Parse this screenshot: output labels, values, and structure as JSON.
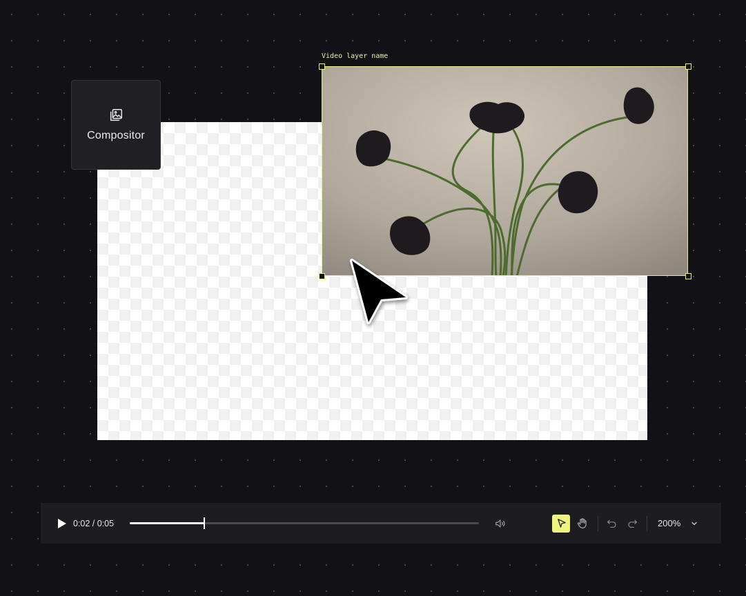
{
  "compositor": {
    "label": "Compositor",
    "icon": "image-stack-icon"
  },
  "video_layer": {
    "name": "Video layer name",
    "selection_color": "#e6f08a"
  },
  "player": {
    "time": "0:02 / 0:05",
    "progress_fraction": 0.214,
    "zoom": "200%"
  },
  "tools": {
    "select": {
      "icon": "cursor-arrow-icon",
      "active": true,
      "active_color": "#eef57d"
    },
    "pan": {
      "icon": "hand-icon",
      "active": false
    },
    "undo": {
      "icon": "undo-icon"
    },
    "redo": {
      "icon": "redo-icon"
    }
  },
  "colors": {
    "background": "#111116",
    "toolbar": "#1d1d21",
    "accent": "#eef57d"
  }
}
